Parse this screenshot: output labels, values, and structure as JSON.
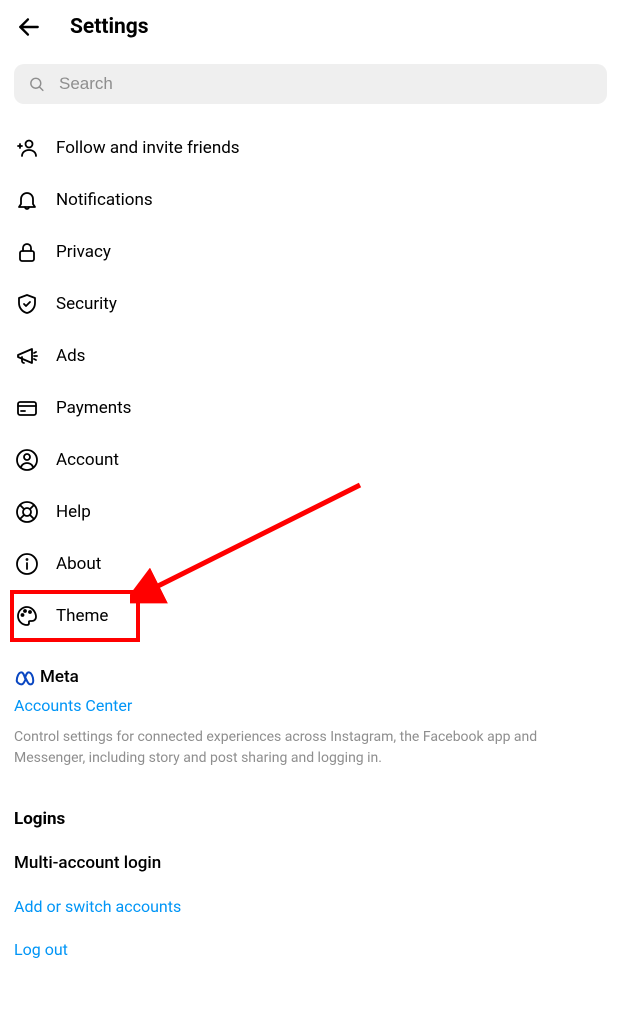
{
  "header": {
    "title": "Settings"
  },
  "search": {
    "placeholder": "Search"
  },
  "settings_items": {
    "follow": "Follow and invite friends",
    "notifications": "Notifications",
    "privacy": "Privacy",
    "security": "Security",
    "ads": "Ads",
    "payments": "Payments",
    "account": "Account",
    "help": "Help",
    "about": "About",
    "theme": "Theme"
  },
  "meta": {
    "brand": "Meta",
    "accounts_center": "Accounts Center",
    "description": "Control settings for connected experiences across Instagram, the Facebook app and Messenger, including story and post sharing and logging in."
  },
  "logins": {
    "header": "Logins",
    "multi_account": "Multi-account login",
    "add_switch": "Add or switch accounts",
    "logout": "Log out"
  }
}
